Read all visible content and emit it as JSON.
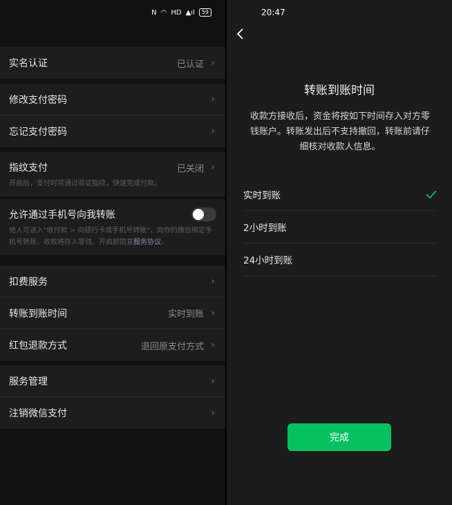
{
  "left": {
    "status_icons": {
      "nfc": "N",
      "wifi": "◠",
      "hd": "HD",
      "signal": "▲ıl",
      "battery": "59"
    },
    "group1": {
      "real_name": {
        "label": "实名认证",
        "value": "已认证"
      }
    },
    "group2": {
      "change_password": {
        "label": "修改支付密码"
      },
      "forgot_password": {
        "label": "忘记支付密码"
      }
    },
    "group3": {
      "fingerprint": {
        "label": "指纹支付",
        "value": "已关闭",
        "desc": "开启后，支付时可通过验证指纹，快速完成付款。"
      }
    },
    "group4": {
      "phone_transfer": {
        "label": "允许通过手机号向我转账",
        "desc": "他人可进入\"收付款 > 向银行卡或手机号转账\"，向你的微信绑定手机号转账，收款将存入零钱。开启即同意",
        "link": "服务协议",
        "suffix": "。",
        "toggle_on": false
      }
    },
    "group5": {
      "deduction": {
        "label": "扣费服务"
      },
      "transfer_time": {
        "label": "转账到账时间",
        "value": "实时到账"
      },
      "refund_method": {
        "label": "红包退款方式",
        "value": "退回原支付方式"
      }
    },
    "group6": {
      "service_manage": {
        "label": "服务管理"
      },
      "cancel_pay": {
        "label": "注销微信支付"
      }
    }
  },
  "right": {
    "status_time": "20:47",
    "title": "转账到账时间",
    "description": "收款方接收后，资金将按如下时间存入对方零钱账户。转账发出后不支持撤回，转账前请仔细核对收款人信息。",
    "options": [
      {
        "label": "实时到账",
        "selected": true
      },
      {
        "label": "2小时到账",
        "selected": false
      },
      {
        "label": "24小时到账",
        "selected": false
      }
    ],
    "done_label": "完成"
  },
  "colors": {
    "accent": "#07c160",
    "link": "#7d90a9"
  }
}
